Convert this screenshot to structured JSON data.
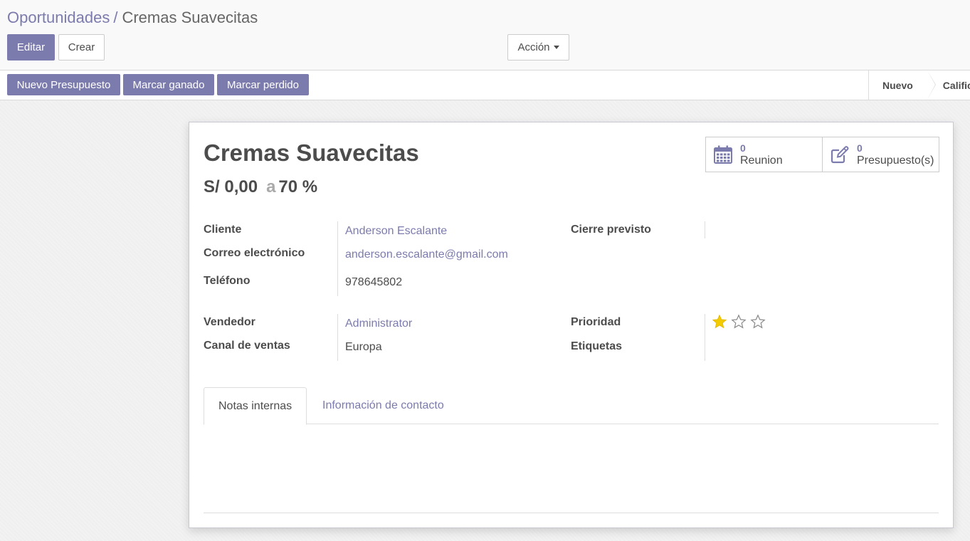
{
  "breadcrumb": {
    "parent": "Oportunidades",
    "separator": "/",
    "current": "Cremas Suavecitas"
  },
  "toolbar": {
    "edit_label": "Editar",
    "create_label": "Crear",
    "action_label": "Acción"
  },
  "statusbar": {
    "buttons": [
      "Nuevo Presupuesto",
      "Marcar ganado",
      "Marcar perdido"
    ],
    "stages": [
      "Nuevo",
      "Calific"
    ]
  },
  "record": {
    "title": "Cremas Suavecitas",
    "revenue": "S/ 0,00",
    "at_word": "a",
    "probability": "70 %"
  },
  "smart_buttons": [
    {
      "count": "0",
      "label": "Reunion",
      "icon": "calendar-icon"
    },
    {
      "count": "0",
      "label": "Presupuesto(s)",
      "icon": "edit-icon"
    }
  ],
  "fields": {
    "customer_label": "Cliente",
    "customer_value": "Anderson Escalante",
    "email_label": "Correo electrónico",
    "email_value": "anderson.escalante@gmail.com",
    "phone_label": "Teléfono",
    "phone_value": "978645802",
    "deadline_label": "Cierre previsto",
    "deadline_value": "",
    "salesperson_label": "Vendedor",
    "salesperson_value": "Administrator",
    "team_label": "Canal de ventas",
    "team_value": "Europa",
    "priority_label": "Prioridad",
    "priority_value": 1,
    "priority_max": 3,
    "tags_label": "Etiquetas"
  },
  "tabs": [
    "Notas internas",
    "Información de contacto"
  ],
  "colors": {
    "accent": "#7c7bad",
    "star": "#f3cc00",
    "text": "#4c4c4c"
  }
}
